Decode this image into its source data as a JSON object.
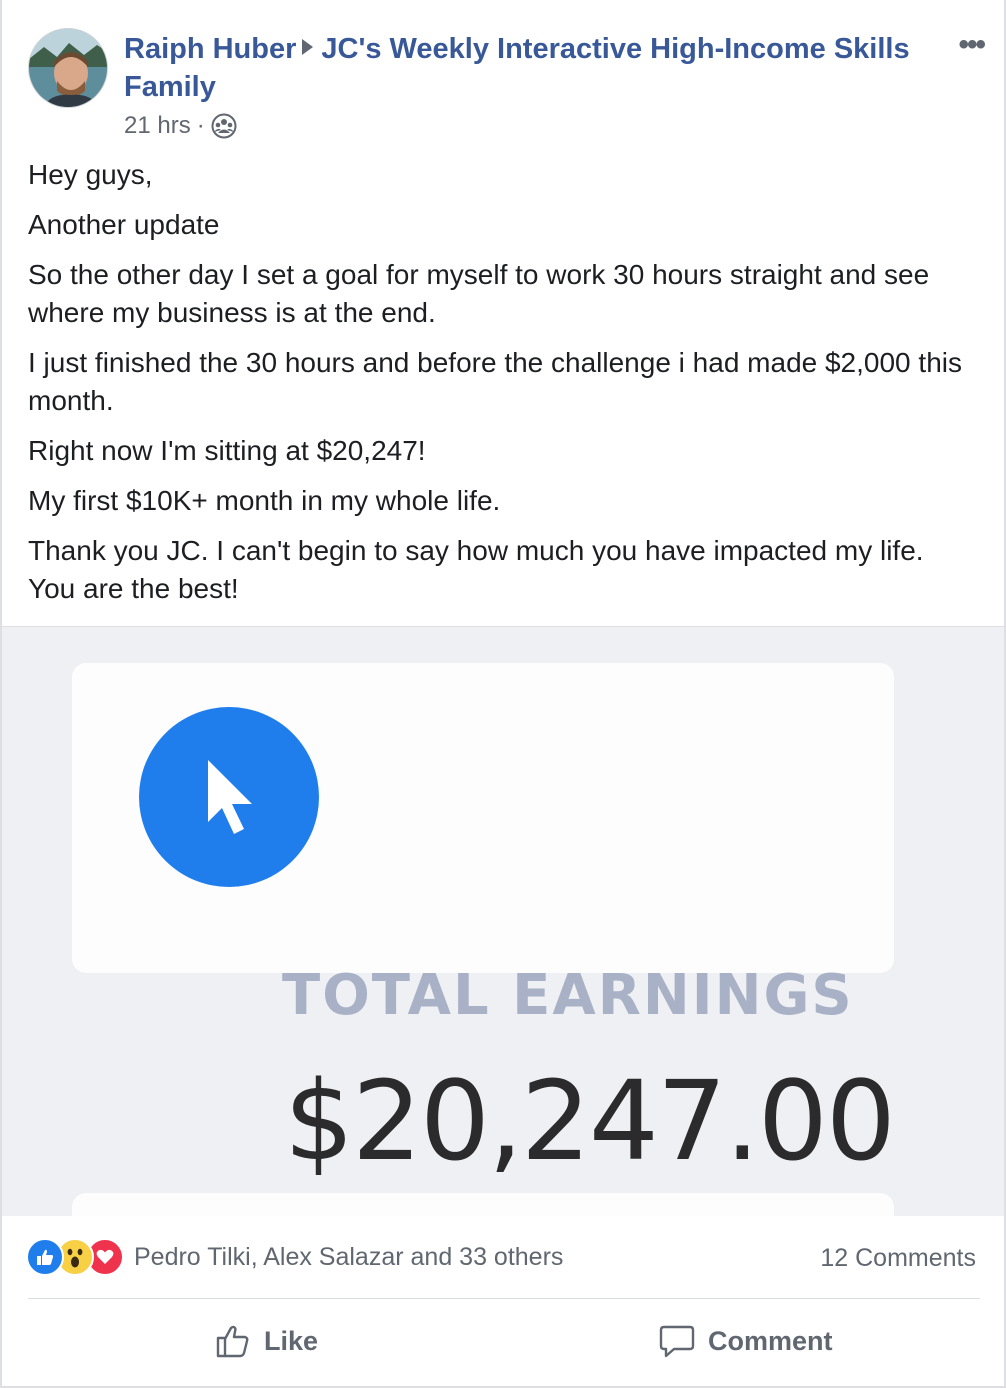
{
  "post": {
    "author": "Raiph Huber",
    "group": "JC's Weekly Interactive High-Income Skills Family",
    "time": "21 hrs",
    "dot": "·",
    "more_label": "•••",
    "paragraphs": [
      "Hey guys,",
      "Another update",
      "So the other day I set a goal for myself to work 30 hours straight and see where my business is at the end.",
      "I just finished the 30 hours and before the challenge i had made $2,000 this month.",
      "Right now I'm sitting at $20,247!",
      "My first $10K+ month in my whole life.",
      "Thank you JC. I can't begin to say how much you have impacted my life. You are the best!"
    ]
  },
  "image": {
    "label": "TOTAL EARNINGS",
    "value": "$20,247.00"
  },
  "reactions": {
    "names": "Pedro Tilki, Alex Salazar and 33 others",
    "comments": "12 Comments",
    "icons": [
      "like-icon",
      "wow-icon",
      "love-icon"
    ]
  },
  "actions": {
    "like": "Like",
    "comment": "Comment"
  },
  "colors": {
    "link": "#385898",
    "muted": "#606770",
    "accent": "#1f7eec"
  }
}
